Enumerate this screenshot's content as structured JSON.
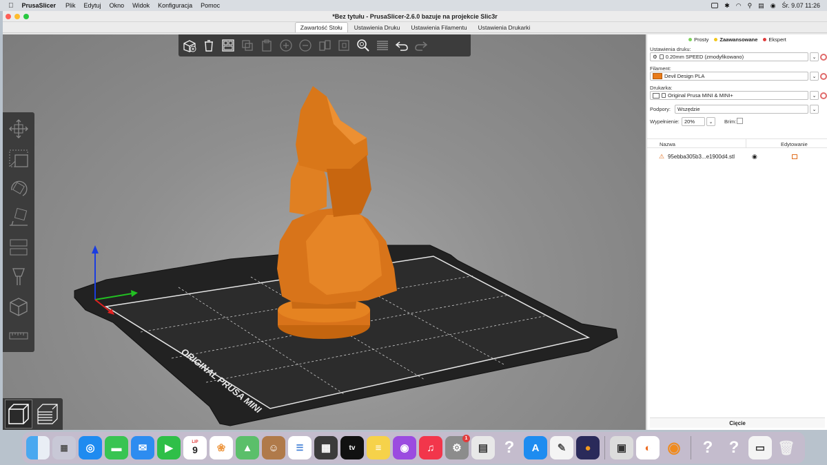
{
  "menubar": {
    "app_name": "PrusaSlicer",
    "items": [
      "Plik",
      "Edytuj",
      "Okno",
      "Widok",
      "Konfiguracja",
      "Pomoc"
    ],
    "clock": "Śr. 9.07  11:26"
  },
  "window": {
    "title": "*Bez tytułu - PrusaSlicer-2.6.0 bazuje na projekcie Slic3r"
  },
  "tabs": [
    "Zawartość Stołu",
    "Ustawienia Druku",
    "Ustawienia Filamentu",
    "Ustawienia Drukarki"
  ],
  "bed": {
    "label": "ORIGINAL PRUSA MINI"
  },
  "modes": [
    {
      "label": "Prosty",
      "color": "#7dd35a"
    },
    {
      "label": "Zaawansowane",
      "color": "#f2c61b"
    },
    {
      "label": "Ekspert",
      "color": "#e03b3b"
    }
  ],
  "sidebar": {
    "print_settings_label": "Ustawienia druku:",
    "print_settings_value": "0.20mm SPEED (zmodyfikowano)",
    "filament_label": "Filament:",
    "filament_value": "Devil Design PLA",
    "filament_color": "#e87b1a",
    "printer_label": "Drukarka:",
    "printer_value": "Original Prusa MINI & MINI+",
    "supports_label": "Podpory:",
    "supports_value": "Wszędzie",
    "infill_label": "Wypełnienie:",
    "infill_value": "20%",
    "brim_label": "Brim:",
    "col_name": "Nazwa",
    "col_edit": "Edytowanie",
    "object_name": "95ebba305b3...e1900d4.stl",
    "slice_button": "Cięcie"
  },
  "dock": {
    "calendar_month": "LIP",
    "calendar_day": "9",
    "settings_badge": "1",
    "tv_label": "tv"
  },
  "colors": {
    "model": "#e0781c",
    "accent": "#ed6b21"
  }
}
